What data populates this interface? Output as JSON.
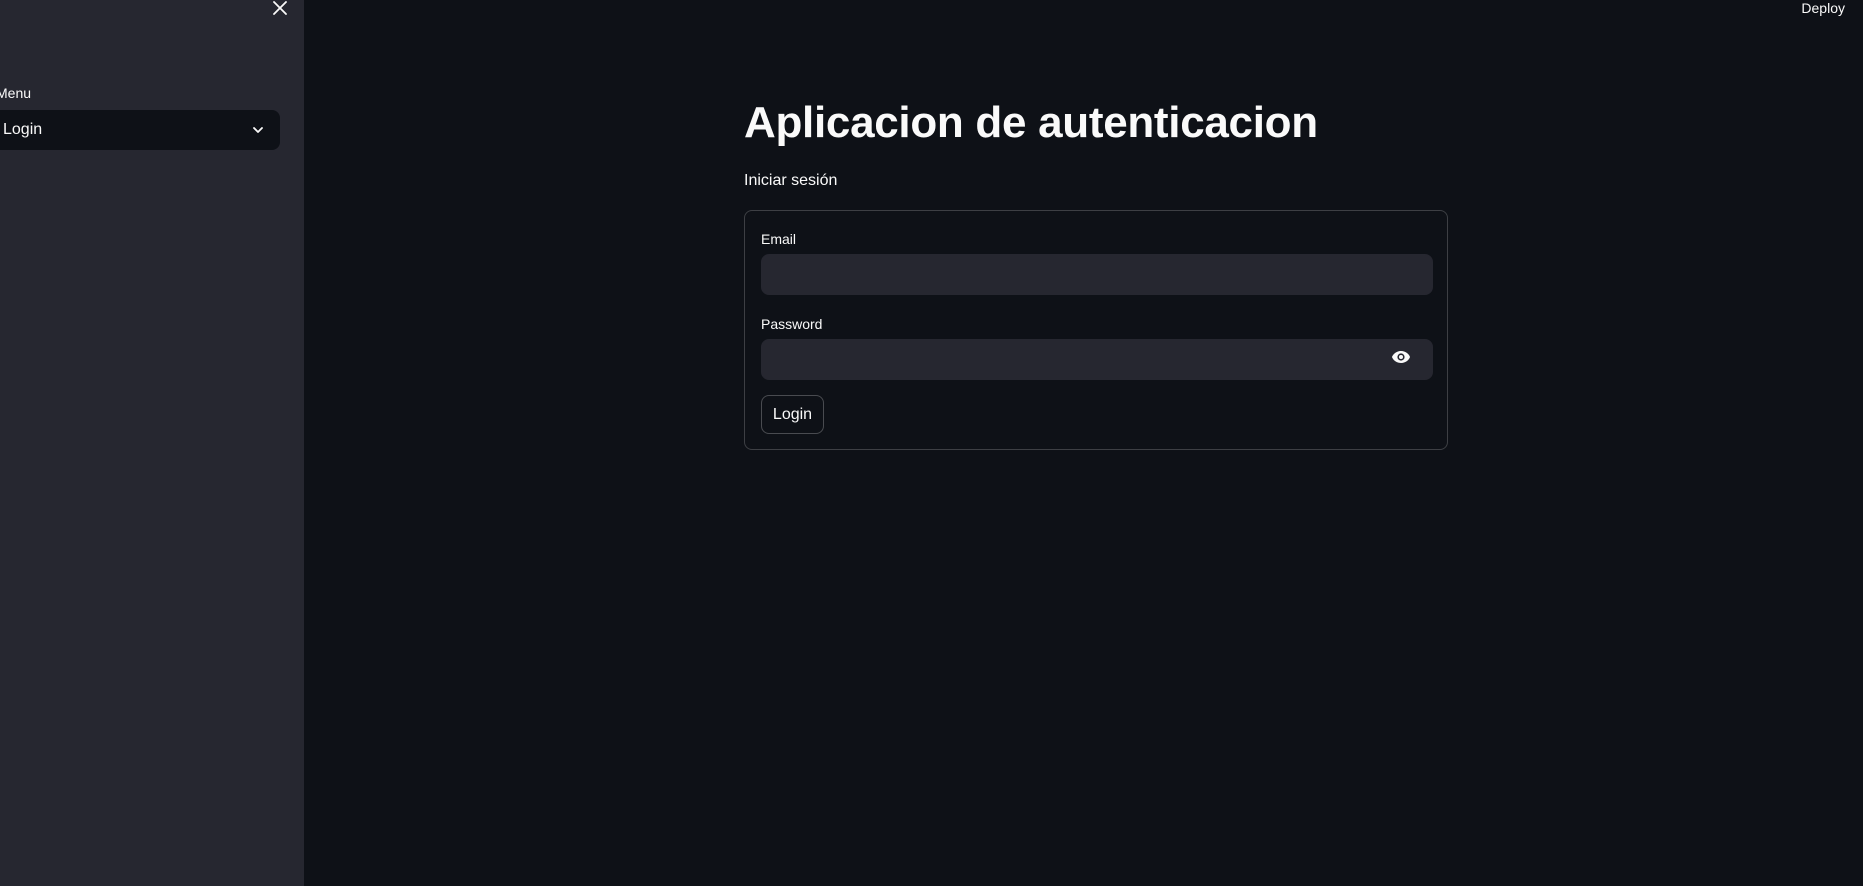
{
  "sidebar": {
    "close_icon": "close-icon",
    "menu_label": "Menu",
    "select": {
      "value": "Login",
      "chevron_icon": "chevron-down-icon"
    }
  },
  "header": {
    "deploy_label": "Deploy"
  },
  "main": {
    "title": "Aplicacion de autenticacion",
    "subtitle": "Iniciar sesión",
    "form": {
      "email_label": "Email",
      "email_value": "",
      "password_label": "Password",
      "password_value": "",
      "password_toggle_icon": "eye-icon",
      "submit_label": "Login"
    }
  },
  "colors": {
    "background": "#0e1117",
    "sidebar": "#262730",
    "input": "#262730",
    "text": "#fafafa"
  }
}
